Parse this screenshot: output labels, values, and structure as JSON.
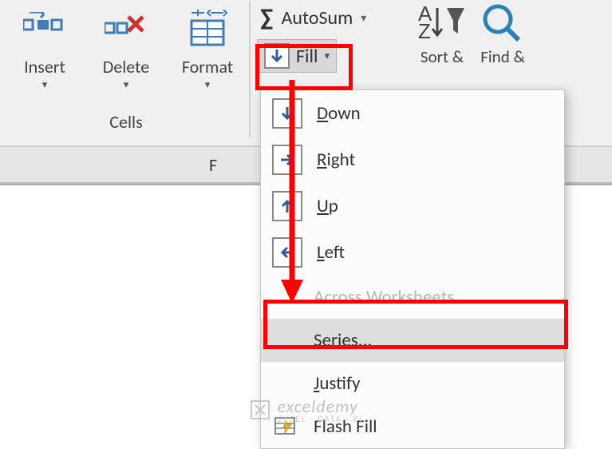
{
  "ribbon": {
    "cells_group_label": "Cells",
    "insert_label": "Insert",
    "delete_label": "Delete",
    "format_label": "Format"
  },
  "editing": {
    "autosum_label": "AutoSum",
    "fill_label": "Fill",
    "sort_label": "Sort &",
    "find_label": "Find &"
  },
  "column_header": "F",
  "fill_menu": {
    "down": "Down",
    "right": "Right",
    "up": "Up",
    "left": "Left",
    "across": "Across Worksheets...",
    "series": "Series...",
    "justify": "Justify",
    "flash": "Flash Fill"
  },
  "watermark": {
    "brand": "exceldemy",
    "tagline": "EXCEL · DATA · BI"
  }
}
